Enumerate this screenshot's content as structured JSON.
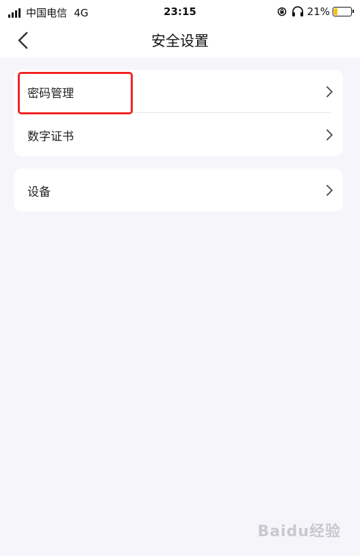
{
  "status_bar": {
    "carrier": "中国电信",
    "network": "4G",
    "time": "23:15",
    "battery_percent": "21%",
    "battery_level": 0.21
  },
  "nav": {
    "title": "安全设置",
    "back_icon": "chevron-left-icon"
  },
  "settings": {
    "group1": [
      {
        "label": "密码管理"
      },
      {
        "label": "数字证书"
      }
    ],
    "group2": [
      {
        "label": "设备"
      }
    ]
  },
  "watermark": "Baidu经验",
  "colors": {
    "highlight": "#f02424",
    "background": "#f5f5fa",
    "battery": "#f2c300"
  }
}
